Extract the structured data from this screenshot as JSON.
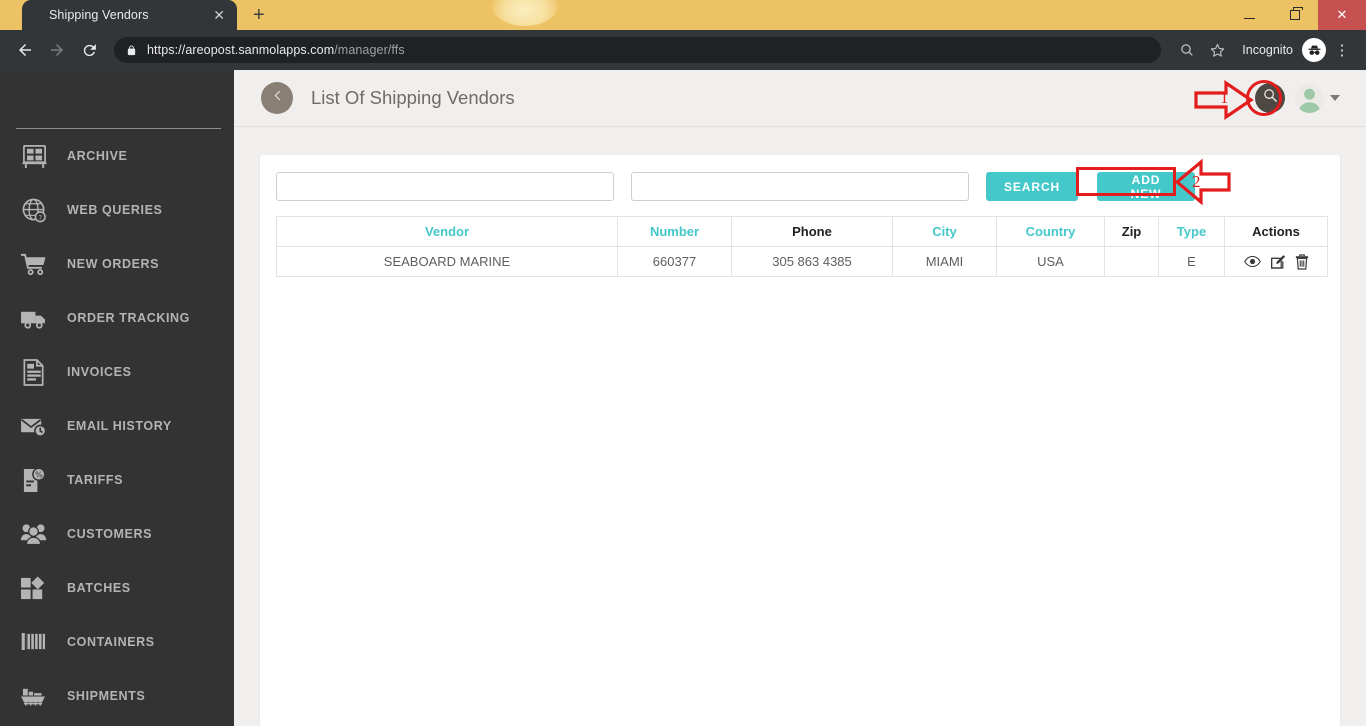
{
  "browser": {
    "tab_title": "Shipping Vendors",
    "tab_close_glyph": "✕",
    "new_tab_glyph": "+",
    "window_close_glyph": "✕",
    "url_secure": "https://areopost.sanmolapps.com",
    "url_path": "/manager/ffs",
    "profile_label": "Incognito",
    "menu_glyph": "⋮"
  },
  "sidebar": {
    "items": [
      {
        "label": "ARCHIVE",
        "icon": "archive-icon"
      },
      {
        "label": "WEB QUERIES",
        "icon": "globe-query-icon"
      },
      {
        "label": "NEW ORDERS",
        "icon": "shopping-cart-icon"
      },
      {
        "label": "ORDER TRACKING",
        "icon": "truck-icon"
      },
      {
        "label": "INVOICES",
        "icon": "invoice-document-icon"
      },
      {
        "label": "EMAIL HISTORY",
        "icon": "envelope-clock-icon"
      },
      {
        "label": "TARIFFS",
        "icon": "tariff-percent-icon"
      },
      {
        "label": "CUSTOMERS",
        "icon": "people-group-icon"
      },
      {
        "label": "BATCHES",
        "icon": "batches-shapes-icon"
      },
      {
        "label": "CONTAINERS",
        "icon": "shipping-container-icon"
      },
      {
        "label": "SHIPMENTS",
        "icon": "cargo-ship-icon"
      }
    ]
  },
  "header": {
    "title": "List Of Shipping Vendors",
    "back_icon": "chevron-left-icon",
    "search_icon": "search-icon",
    "avatar_icon": "user-avatar-icon",
    "caret_icon": "chevron-down-icon"
  },
  "filters": {
    "field_1_value": "",
    "field_1_placeholder": "",
    "field_2_value": "",
    "field_2_placeholder": "",
    "search_label": "SEARCH",
    "add_new_label": "ADD NEW"
  },
  "table": {
    "columns": [
      {
        "label": "Vendor",
        "sortable": true
      },
      {
        "label": "Number",
        "sortable": true
      },
      {
        "label": "Phone",
        "sortable": false
      },
      {
        "label": "City",
        "sortable": true
      },
      {
        "label": "Country",
        "sortable": true
      },
      {
        "label": "Zip",
        "sortable": false
      },
      {
        "label": "Type",
        "sortable": true
      },
      {
        "label": "Actions",
        "sortable": false
      }
    ],
    "rows": [
      {
        "vendor": "SEABOARD MARINE",
        "number": "660377",
        "phone": "305 863 4385",
        "city": "MIAMI",
        "country": "USA",
        "zip": "",
        "type": "E",
        "actions": [
          "view-icon",
          "edit-icon",
          "delete-icon"
        ]
      }
    ]
  },
  "annotations": [
    {
      "number": "1",
      "target": "search-icon-header",
      "shape": "circle",
      "direction": "right"
    },
    {
      "number": "2",
      "target": "add-new-button",
      "shape": "rect",
      "direction": "left"
    }
  ],
  "colors": {
    "accent_teal": "#45c8ca",
    "annotation_red": "#e31d1d",
    "sidebar_bg": "#333333",
    "page_bg": "#f1efed",
    "tabstrip_yellow": "#edc264"
  }
}
